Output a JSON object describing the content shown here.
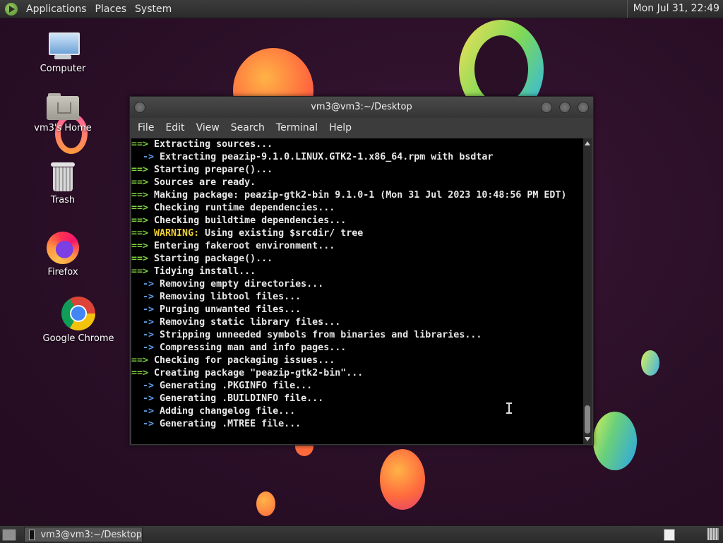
{
  "top_panel": {
    "menus": [
      "Applications",
      "Places",
      "System"
    ],
    "clock": "Mon Jul 31, 22:49"
  },
  "desktop_icons": [
    {
      "label": "Computer",
      "icon": "computer-icon"
    },
    {
      "label": "vm3's Home",
      "icon": "home-folder-icon"
    },
    {
      "label": "Trash",
      "icon": "trash-icon"
    },
    {
      "label": "Firefox",
      "icon": "firefox-icon"
    },
    {
      "label": "Google Chrome",
      "icon": "chrome-icon"
    }
  ],
  "terminal": {
    "title": "vm3@vm3:~/Desktop",
    "menu": [
      "File",
      "Edit",
      "View",
      "Search",
      "Terminal",
      "Help"
    ],
    "lines": [
      {
        "prefix": "==> ",
        "kind": "g",
        "text": "Extracting sources..."
      },
      {
        "prefix": "  -> ",
        "kind": "b",
        "text": "Extracting peazip-9.1.0.LINUX.GTK2-1.x86_64.rpm with bsdtar"
      },
      {
        "prefix": "==> ",
        "kind": "g",
        "text": "Starting prepare()..."
      },
      {
        "prefix": "==> ",
        "kind": "g",
        "text": "Sources are ready."
      },
      {
        "prefix": "==> ",
        "kind": "g",
        "text": "Making package: peazip-gtk2-bin 9.1.0-1 (Mon 31 Jul 2023 10:48:56 PM EDT)"
      },
      {
        "prefix": "==> ",
        "kind": "g",
        "text": "Checking runtime dependencies..."
      },
      {
        "prefix": "==> ",
        "kind": "g",
        "text": "Checking buildtime dependencies..."
      },
      {
        "prefix": "==> ",
        "kind": "g",
        "warn": "WARNING:",
        "text": " Using existing $srcdir/ tree"
      },
      {
        "prefix": "==> ",
        "kind": "g",
        "text": "Entering fakeroot environment..."
      },
      {
        "prefix": "==> ",
        "kind": "g",
        "text": "Starting package()..."
      },
      {
        "prefix": "==> ",
        "kind": "g",
        "text": "Tidying install..."
      },
      {
        "prefix": "  -> ",
        "kind": "b",
        "text": "Removing empty directories..."
      },
      {
        "prefix": "  -> ",
        "kind": "b",
        "text": "Removing libtool files..."
      },
      {
        "prefix": "  -> ",
        "kind": "b",
        "text": "Purging unwanted files..."
      },
      {
        "prefix": "  -> ",
        "kind": "b",
        "text": "Removing static library files..."
      },
      {
        "prefix": "  -> ",
        "kind": "b",
        "text": "Stripping unneeded symbols from binaries and libraries..."
      },
      {
        "prefix": "  -> ",
        "kind": "b",
        "text": "Compressing man and info pages..."
      },
      {
        "prefix": "==> ",
        "kind": "g",
        "text": "Checking for packaging issues..."
      },
      {
        "prefix": "==> ",
        "kind": "g",
        "text": "Creating package \"peazip-gtk2-bin\"..."
      },
      {
        "prefix": "  -> ",
        "kind": "b",
        "text": "Generating .PKGINFO file..."
      },
      {
        "prefix": "  -> ",
        "kind": "b",
        "text": "Generating .BUILDINFO file..."
      },
      {
        "prefix": "  -> ",
        "kind": "b",
        "text": "Adding changelog file..."
      },
      {
        "prefix": "  -> ",
        "kind": "b",
        "text": "Generating .MTREE file..."
      }
    ]
  },
  "taskbar": {
    "window_button": "vm3@vm3:~/Desktop"
  },
  "colors": {
    "arrow_green": "#7fcf3f",
    "arrow_blue": "#5a9ee8",
    "warning_yellow": "#f0d030",
    "terminal_bg": "#000000"
  }
}
